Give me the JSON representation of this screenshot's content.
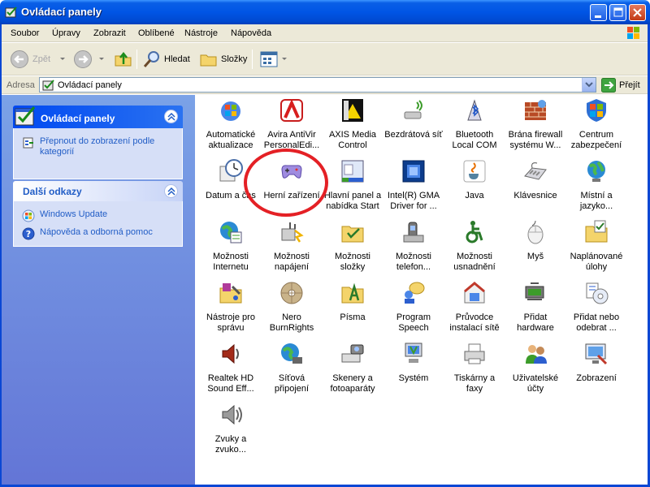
{
  "window": {
    "title": "Ovládací panely"
  },
  "menu": [
    "Soubor",
    "Úpravy",
    "Zobrazit",
    "Oblíbené",
    "Nástroje",
    "Nápověda"
  ],
  "toolbar": {
    "back_label": "Zpět",
    "search_label": "Hledat",
    "folders_label": "Složky"
  },
  "address": {
    "label": "Adresa",
    "value": "Ovládací panely",
    "go_label": "Přejít"
  },
  "panels": {
    "control_panel": {
      "title": "Ovládací panely",
      "link": "Přepnout do zobrazení podle kategorií"
    },
    "see_also": {
      "title": "Další odkazy",
      "links": [
        "Windows Update",
        "Nápověda a odborná pomoc"
      ]
    }
  },
  "items": [
    {
      "label": "Automatické\naktualizace",
      "icon": "automatic-updates-icon"
    },
    {
      "label": "Avira AntiVir\nPersonalEdi...",
      "icon": "avira-icon"
    },
    {
      "label": "AXIS Media\nControl",
      "icon": "axis-media-icon"
    },
    {
      "label": "Bezdrátová síť",
      "icon": "wireless-network-icon"
    },
    {
      "label": "Bluetooth\nLocal COM",
      "icon": "bluetooth-icon"
    },
    {
      "label": "Brána firewall\nsystému W...",
      "icon": "firewall-icon"
    },
    {
      "label": "Centrum\nzabezpečení",
      "icon": "security-center-icon"
    },
    {
      "label": "Datum a čas",
      "icon": "date-time-icon"
    },
    {
      "label": "Herní zařízení",
      "icon": "game-controller-icon"
    },
    {
      "label": "Hlavní panel a\nnabídka Start",
      "icon": "taskbar-icon"
    },
    {
      "label": "Intel(R) GMA\nDriver for ...",
      "icon": "intel-gma-icon"
    },
    {
      "label": "Java",
      "icon": "java-icon"
    },
    {
      "label": "Klávesnice",
      "icon": "keyboard-icon"
    },
    {
      "label": "Místní a\njazyko...",
      "icon": "regional-icon"
    },
    {
      "label": "Možnosti\nInternetu",
      "icon": "internet-options-icon"
    },
    {
      "label": "Možnosti\nnapájení",
      "icon": "power-options-icon"
    },
    {
      "label": "Možnosti\nsložky",
      "icon": "folder-options-icon"
    },
    {
      "label": "Možnosti\ntelefon...",
      "icon": "phone-modem-icon"
    },
    {
      "label": "Možnosti\nusnadnění",
      "icon": "accessibility-icon"
    },
    {
      "label": "Myš",
      "icon": "mouse-icon"
    },
    {
      "label": "Naplánované\núlohy",
      "icon": "scheduled-tasks-icon"
    },
    {
      "label": "Nástroje pro\nsprávu",
      "icon": "admin-tools-icon"
    },
    {
      "label": "Nero\nBurnRights",
      "icon": "nero-icon"
    },
    {
      "label": "Písma",
      "icon": "fonts-icon"
    },
    {
      "label": "Program\nSpeech",
      "icon": "speech-icon"
    },
    {
      "label": "Průvodce\ninstalací sítě",
      "icon": "network-wizard-icon"
    },
    {
      "label": "Přidat\nhardware",
      "icon": "add-hardware-icon"
    },
    {
      "label": "Přidat nebo\nodebrat ...",
      "icon": "add-remove-programs-icon"
    },
    {
      "label": "Realtek HD\nSound Eff...",
      "icon": "realtek-sound-icon"
    },
    {
      "label": "Síťová\npřipojení",
      "icon": "network-connections-icon"
    },
    {
      "label": "Skenery a\nfotoaparáty",
      "icon": "scanners-icon"
    },
    {
      "label": "Systém",
      "icon": "system-icon"
    },
    {
      "label": "Tiskárny a\nfaxy",
      "icon": "printers-icon"
    },
    {
      "label": "Uživatelské\núčty",
      "icon": "user-accounts-icon"
    },
    {
      "label": "Zobrazení",
      "icon": "display-icon"
    },
    {
      "label": "Zvuky a\nzvuko...",
      "icon": "sounds-icon"
    }
  ]
}
